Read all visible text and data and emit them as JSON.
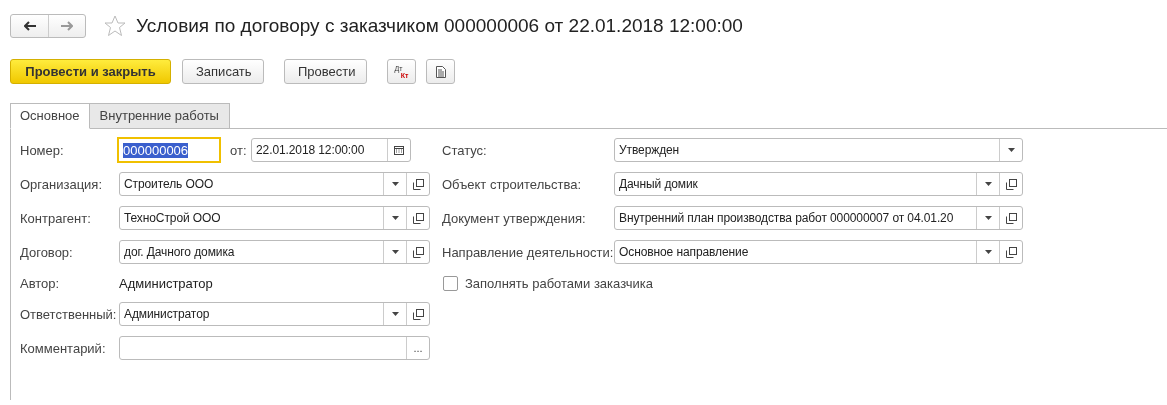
{
  "window": {
    "title": "Условия по договору с заказчиком 000000006 от 22.01.2018 12:00:00",
    "favorite": false
  },
  "toolbar": [
    {
      "kind": "default",
      "label": "Провести и закрыть"
    },
    {
      "kind": "plain",
      "label": "Записать"
    },
    {
      "kind": "plain",
      "label": "Провести"
    },
    {
      "kind": "dtkt",
      "top": "Дт",
      "bottom": "Кт"
    },
    {
      "kind": "report"
    }
  ],
  "tabs": [
    {
      "label": "Основное",
      "selected": true
    },
    {
      "label": "Внутренние работы",
      "selected": false
    }
  ],
  "left_fields": [
    {
      "kind": "number",
      "label": "Номер:",
      "value": "000000006",
      "date_label": "от:",
      "date_value": "22.01.2018 12:00:00"
    },
    {
      "kind": "ref",
      "label": "Организация:",
      "value": "Строитель ООО"
    },
    {
      "kind": "ref",
      "label": "Контрагент:",
      "value": "ТехноСтрой ООО"
    },
    {
      "kind": "ref",
      "label": "Договор:",
      "value": "дог. Дачного домика"
    },
    {
      "kind": "text",
      "label": "Автор:",
      "value": "Администратор"
    },
    {
      "kind": "ref",
      "label": "Ответственный:",
      "value": "Администратор"
    },
    {
      "kind": "comment",
      "label": "Комментарий:",
      "choice": "..."
    }
  ],
  "right_fields": [
    {
      "kind": "list",
      "label": "Статус:",
      "value": "Утвержден"
    },
    {
      "kind": "ref",
      "label": "Объект строительства:",
      "value": "Дачный домик"
    },
    {
      "kind": "ref",
      "label": "Документ утверждения:",
      "value": "Внутренний план производства работ 000000007 от 04.01.20"
    },
    {
      "kind": "ref",
      "label": "Направление деятельности:",
      "value": "Основное направление"
    },
    {
      "kind": "checkbox",
      "label": "Заполнять работами заказчика",
      "checked": false
    }
  ]
}
